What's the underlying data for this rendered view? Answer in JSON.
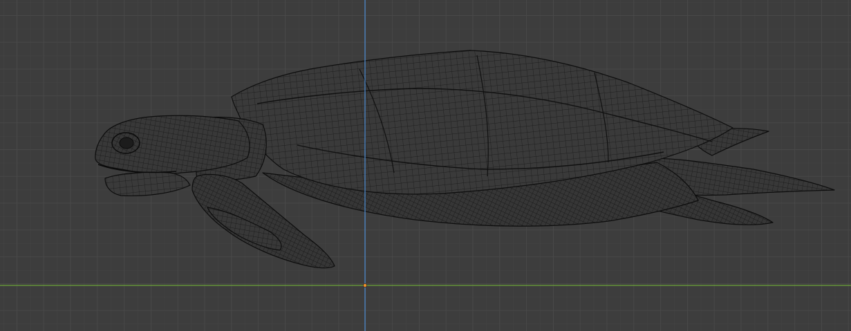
{
  "viewport": {
    "view": "side-orthographic",
    "shading": "wireframe",
    "object": "sea-turtle-mesh"
  },
  "colors": {
    "background": "#3d3d3d",
    "grid_minor": "#464646",
    "grid_major": "#4f4f4f",
    "axis_x": "#72a53c",
    "axis_z": "#4a85c9",
    "wire": "#111111",
    "mesh_fill": "#3a3a3a",
    "origin": "#f0902a"
  }
}
